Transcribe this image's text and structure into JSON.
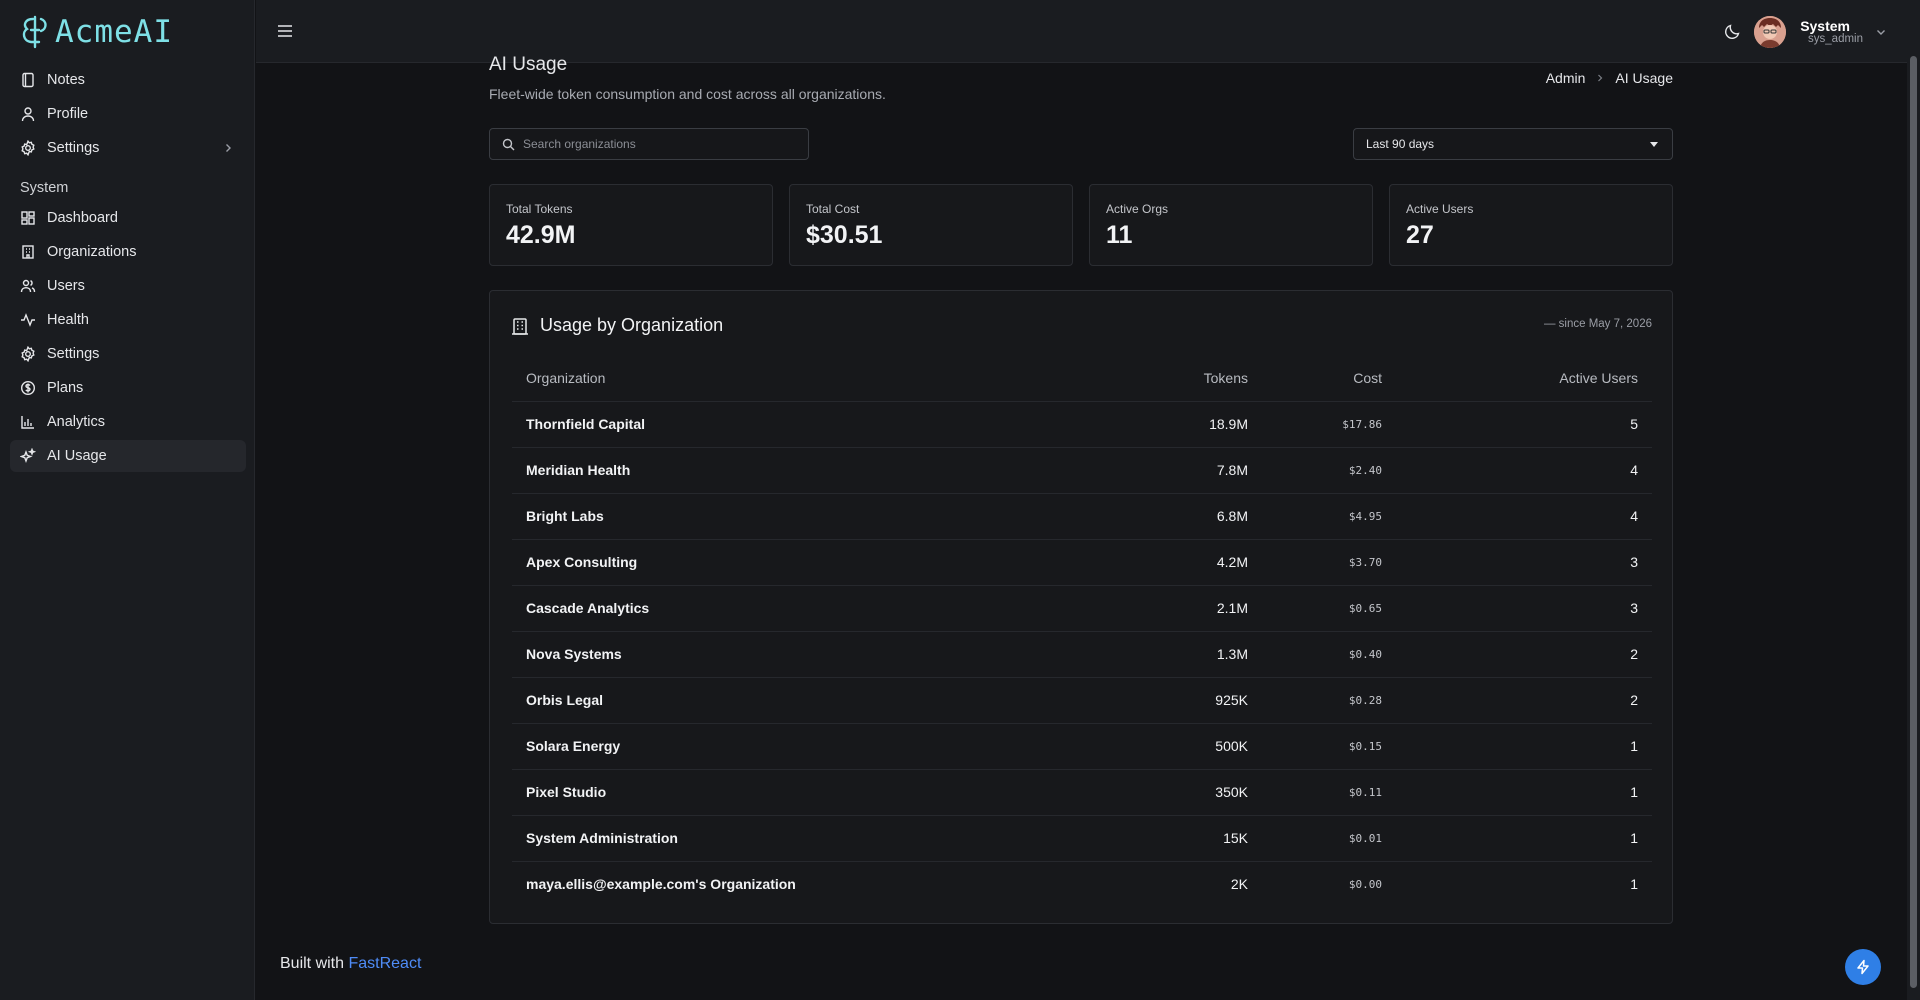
{
  "app": {
    "logo_text": "AcmeAI"
  },
  "sidebar": {
    "items": [
      {
        "label": "Notes",
        "icon": "notebook-icon"
      },
      {
        "label": "Profile",
        "icon": "user-icon"
      },
      {
        "label": "Settings",
        "icon": "gear-icon"
      }
    ],
    "section_label": "System",
    "system_items": [
      {
        "label": "Dashboard",
        "icon": "dashboard-icon"
      },
      {
        "label": "Organizations",
        "icon": "building-icon"
      },
      {
        "label": "Users",
        "icon": "users-icon"
      },
      {
        "label": "Health",
        "icon": "activity-icon"
      },
      {
        "label": "Settings",
        "icon": "gear-icon"
      },
      {
        "label": "Plans",
        "icon": "dollar-circle-icon"
      },
      {
        "label": "Analytics",
        "icon": "bar-chart-icon"
      },
      {
        "label": "AI Usage",
        "icon": "sparkles-icon"
      }
    ],
    "footer_prefix": "Built with",
    "footer_link": "FastReact"
  },
  "header": {
    "user_name": "System",
    "user_handle": "sys_admin"
  },
  "page": {
    "title": "AI Usage",
    "subtitle": "Fleet-wide token consumption and cost across all organizations.",
    "breadcrumb": [
      "Admin",
      "AI Usage"
    ],
    "search_placeholder": "Search organizations",
    "range_selected": "Last 90 days"
  },
  "stats": [
    {
      "label": "Total Tokens",
      "value": "42.9M"
    },
    {
      "label": "Total Cost",
      "value": "$30.51"
    },
    {
      "label": "Active Orgs",
      "value": "11"
    },
    {
      "label": "Active Users",
      "value": "27"
    }
  ],
  "usage": {
    "title": "Usage by Organization",
    "meta": "— since May 7, 2026",
    "columns": [
      "Organization",
      "Tokens",
      "Cost",
      "Active Users"
    ],
    "rows": [
      {
        "org": "Thornfield Capital",
        "tokens": "18.9M",
        "cost": "$17.86",
        "users": "5"
      },
      {
        "org": "Meridian Health",
        "tokens": "7.8M",
        "cost": "$2.40",
        "users": "4"
      },
      {
        "org": "Bright Labs",
        "tokens": "6.8M",
        "cost": "$4.95",
        "users": "4"
      },
      {
        "org": "Apex Consulting",
        "tokens": "4.2M",
        "cost": "$3.70",
        "users": "3"
      },
      {
        "org": "Cascade Analytics",
        "tokens": "2.1M",
        "cost": "$0.65",
        "users": "3"
      },
      {
        "org": "Nova Systems",
        "tokens": "1.3M",
        "cost": "$0.40",
        "users": "2"
      },
      {
        "org": "Orbis Legal",
        "tokens": "925K",
        "cost": "$0.28",
        "users": "2"
      },
      {
        "org": "Solara Energy",
        "tokens": "500K",
        "cost": "$0.15",
        "users": "1"
      },
      {
        "org": "Pixel Studio",
        "tokens": "350K",
        "cost": "$0.11",
        "users": "1"
      },
      {
        "org": "System Administration",
        "tokens": "15K",
        "cost": "$0.01",
        "users": "1"
      },
      {
        "org": "maya.ellis@example.com's Organization",
        "tokens": "2K",
        "cost": "$0.00",
        "users": "1"
      }
    ]
  },
  "colors": {
    "accent": "#7ee0e6",
    "link": "#4f8cf7",
    "fab": "#2f7fe6"
  }
}
